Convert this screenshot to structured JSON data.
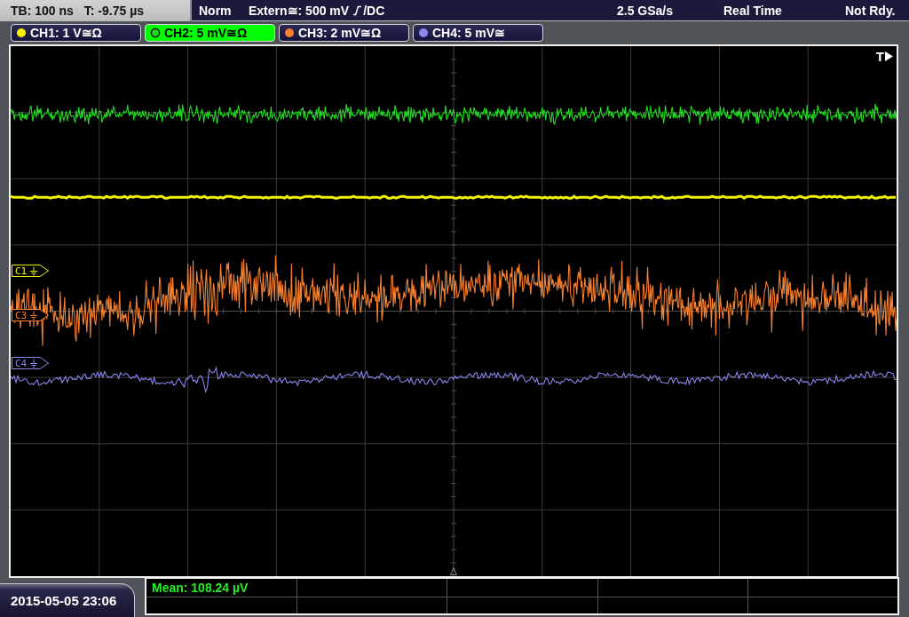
{
  "top_bar": {
    "timebase": "TB: 100 ns",
    "trigger_time": "T: -9.75 µs",
    "trigger_mode": "Norm",
    "trigger_source": "Extern≅: 500 mV",
    "trigger_coupling": "/DC",
    "sample_rate": "2.5 GSa/s",
    "acquisition_mode": "Real Time",
    "status": "Not Rdy."
  },
  "channels": [
    {
      "label": "CH1: 1 V≅Ω",
      "color": "#f2f200",
      "selected": false,
      "marker": "C1"
    },
    {
      "label": "CH2: 5 mV≅Ω",
      "color": "#22dd22",
      "selected": true
    },
    {
      "label": "CH3: 2 mV≅Ω",
      "color": "#f58030",
      "selected": false,
      "marker": "C3"
    },
    {
      "label": "CH4: 5 mV≅",
      "color": "#8888ee",
      "selected": false,
      "marker": "C4"
    }
  ],
  "screen": {
    "trigger_label": "T"
  },
  "datetime": "2015-05-05 23:06",
  "measurements": [
    {
      "label": "Mean: 108.24 µV"
    }
  ]
}
